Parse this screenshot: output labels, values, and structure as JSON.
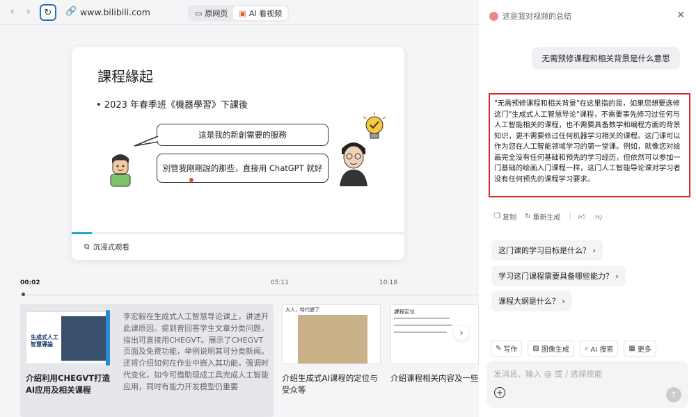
{
  "browser": {
    "back_icon": "‹",
    "forward_icon": "›",
    "reload_icon": "↻",
    "url": "www.bilibili.com",
    "tabs": [
      {
        "label": "原网页",
        "icon": "page-icon"
      },
      {
        "label": "AI 看视频",
        "icon": "ai-video-icon"
      }
    ]
  },
  "slide": {
    "title": "課程緣起",
    "bullet": "• 2023 年春季班《機器學習》下課後",
    "bubble1": "這是我的新創需要的服務",
    "bubble2": "別管我剛剛說的那些，直接用 ChatGPT 就好"
  },
  "player": {
    "progress": 0.06,
    "immersive_label": "沉浸式观看",
    "times": [
      "00:02",
      "05:11",
      "10:18"
    ]
  },
  "chapters": [
    {
      "title": "介绍利用CHEGVT打造AI应用及相关课程",
      "desc": "李宏毅在生成式人工智慧导论课上，讲述开此课原因。提到曾回答学生文章分类问题，指出可直接用CHEGVT。展示了CHEGVT页面及免费功能，举例说明其可分类新闻。还将介绍如何在作业中嵌入其功能。强调时代变化，如今可借助现成工具完成人工智能应用，同时有能力开发模型仍重要",
      "thumb_text": "生成式人工智慧導論"
    },
    {
      "title": "介绍生成式AI课程的定位与受众等",
      "thumb_text": "大人，時代變了"
    },
    {
      "title": "介绍课程相关内容及一些技术概念",
      "thumb_text": "課程定位"
    }
  ],
  "panel": {
    "header": "这是我对视频的总结",
    "user_question": "无需预修课程和相关背景是什么意思",
    "answer": "\"无需预修课程和相关背景\"在这里指的是，如果您想要选修这门\"生成式人工智慧导论\"课程，不需要事先修习过任何与人工智能相关的课程，也不需要具备数学和编程方面的背景知识，更不需要修过任何机器学习相关的课程。这门课可以作为您在人工智能领域学习的第一堂课。例如，就像您对绘画完全没有任何基础和预先的学习经历，但依然可以参加一门基础的绘画入门课程一样，这门人工智能导论课对学习者没有任何预先的课程学习要求。",
    "actions": [
      {
        "label": "复制",
        "icon": "copy-icon"
      },
      {
        "label": "重新生成",
        "icon": "regenerate-icon"
      }
    ],
    "suggestions": [
      "这门课的学习目标是什么？",
      "学习这门课程需要具备哪些能力？",
      "课程大纲是什么？"
    ],
    "tools": [
      {
        "label": "写作",
        "icon": "pen-icon"
      },
      {
        "label": "图像生成",
        "icon": "image-icon"
      },
      {
        "label": "AI 搜索",
        "icon": "search-icon"
      },
      {
        "label": "更多",
        "icon": "grid-icon"
      }
    ],
    "input_placeholder": "发消息、输入 @ 或 / 选择技能"
  },
  "colors": {
    "accent": "#2b6fbe",
    "highlight_border": "#d42a2a",
    "progress": "#23a3d6"
  }
}
